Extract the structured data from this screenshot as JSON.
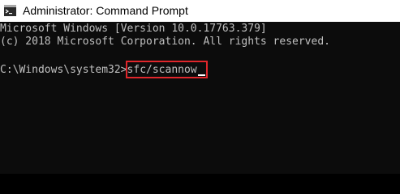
{
  "window": {
    "title": "Administrator: Command Prompt",
    "icon": "cmd-icon"
  },
  "console": {
    "lines": [
      "Microsoft Windows [Version 10.0.17763.379]",
      "(c) 2018 Microsoft Corporation. All rights reserved."
    ],
    "prompt": "C:\\Windows\\system32>",
    "command": "sfc/scannow"
  },
  "colors": {
    "highlight": "#e0262b",
    "console_background": "#0c0c0c",
    "console_text": "#c0c0c0"
  }
}
